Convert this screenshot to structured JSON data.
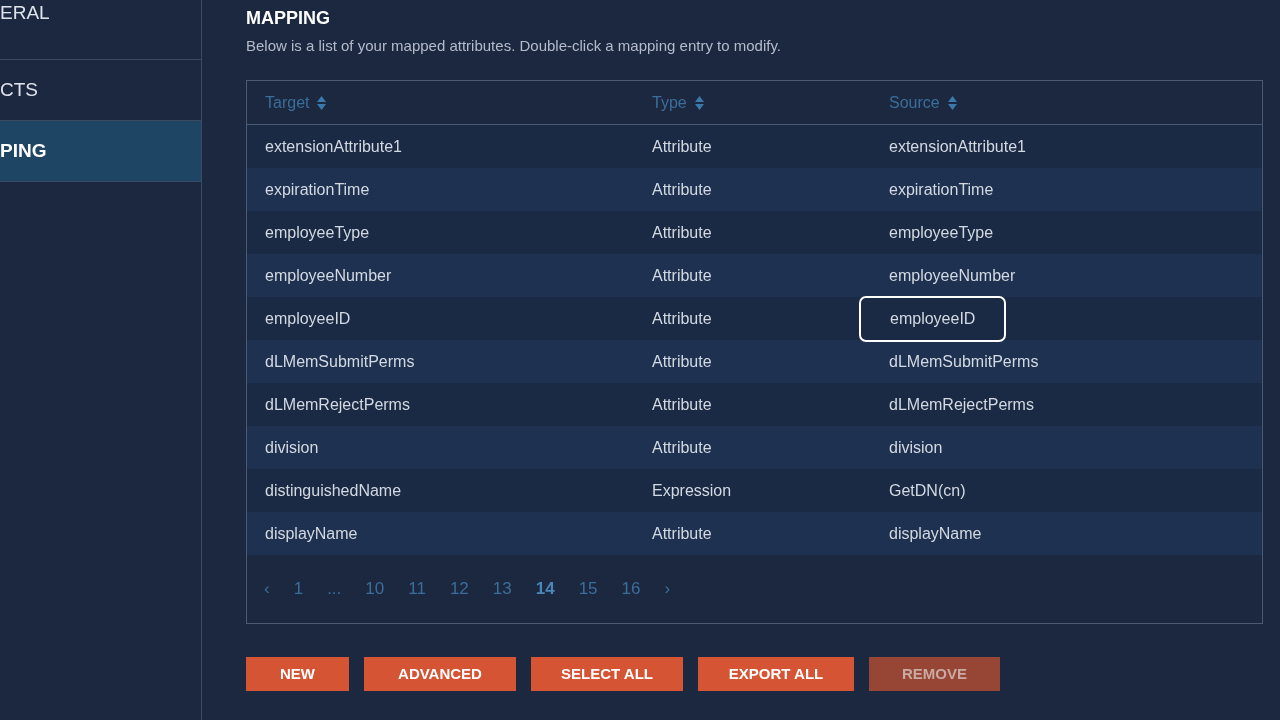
{
  "sidebar": {
    "items": [
      {
        "label": "ERAL",
        "selected": false
      },
      {
        "label": "CTS",
        "selected": false
      },
      {
        "label": "PING",
        "selected": true
      }
    ]
  },
  "section": {
    "title": "MAPPING",
    "description": "Below is a list of your mapped attributes. Double-click a mapping entry to modify."
  },
  "table": {
    "columns": [
      "Target",
      "Type",
      "Source"
    ],
    "rows": [
      {
        "cells": [
          "extensionAttribute1",
          "Attribute",
          "extensionAttribute1"
        ],
        "focused": false
      },
      {
        "cells": [
          "expirationTime",
          "Attribute",
          "expirationTime"
        ],
        "focused": false
      },
      {
        "cells": [
          "employeeType",
          "Attribute",
          "employeeType"
        ],
        "focused": false
      },
      {
        "cells": [
          "employeeNumber",
          "Attribute",
          "employeeNumber"
        ],
        "focused": false
      },
      {
        "cells": [
          "employeeID",
          "Attribute",
          "employeeID"
        ],
        "focused": true
      },
      {
        "cells": [
          "dLMemSubmitPerms",
          "Attribute",
          "dLMemSubmitPerms"
        ],
        "focused": false
      },
      {
        "cells": [
          "dLMemRejectPerms",
          "Attribute",
          "dLMemRejectPerms"
        ],
        "focused": false
      },
      {
        "cells": [
          "division",
          "Attribute",
          "division"
        ],
        "focused": false
      },
      {
        "cells": [
          "distinguishedName",
          "Expression",
          "GetDN(cn)"
        ],
        "focused": false
      },
      {
        "cells": [
          "displayName",
          "Attribute",
          "displayName"
        ],
        "focused": false
      }
    ]
  },
  "pagination": {
    "prev": "‹",
    "next": "›",
    "pages": [
      {
        "label": "1",
        "selected": false
      },
      {
        "label": "...",
        "selected": false
      },
      {
        "label": "10",
        "selected": false
      },
      {
        "label": "11",
        "selected": false
      },
      {
        "label": "12",
        "selected": false
      },
      {
        "label": "13",
        "selected": false
      },
      {
        "label": "14",
        "selected": true
      },
      {
        "label": "15",
        "selected": false
      },
      {
        "label": "16",
        "selected": false
      }
    ]
  },
  "buttons": [
    {
      "label": "NEW",
      "disabled": false
    },
    {
      "label": "ADVANCED",
      "disabled": false
    },
    {
      "label": "SELECT ALL",
      "disabled": false
    },
    {
      "label": "EXPORT ALL",
      "disabled": false
    },
    {
      "label": "REMOVE",
      "disabled": true
    }
  ]
}
